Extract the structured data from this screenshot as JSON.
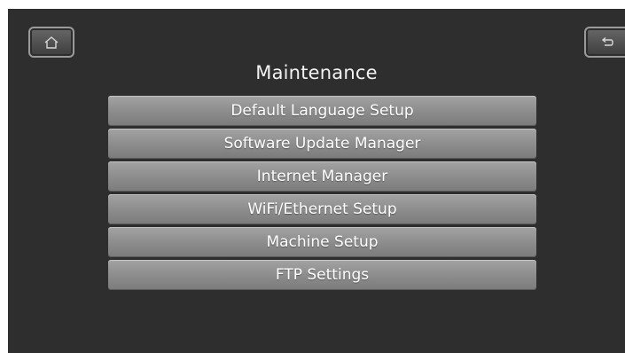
{
  "header": {
    "title": "Maintenance",
    "home_icon": "home-icon",
    "back_icon": "back-arrow-icon"
  },
  "menu": {
    "items": [
      {
        "label": "Default Language Setup"
      },
      {
        "label": "Software Update Manager"
      },
      {
        "label": "Internet Manager"
      },
      {
        "label": "WiFi/Ethernet Setup"
      },
      {
        "label": "Machine Setup"
      },
      {
        "label": "FTP Settings"
      }
    ]
  },
  "colors": {
    "screen_background": "#2e2e2e",
    "menu_button": "#8e8e8e",
    "text": "#ffffff"
  }
}
